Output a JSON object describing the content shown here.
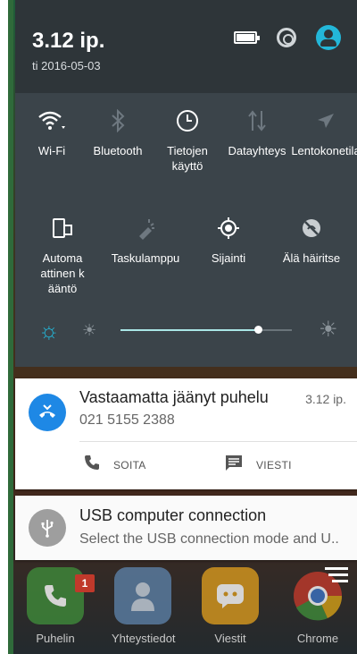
{
  "status": {
    "time": "3.12 ip.",
    "date": "ti 2016-05-03"
  },
  "quick_settings": {
    "row1": [
      {
        "label": "Wi-Fi",
        "icon": "wifi-icon",
        "active": true
      },
      {
        "label": "Bluetooth",
        "icon": "bluetooth-icon",
        "active": false
      },
      {
        "label": "Tietojen käyttö",
        "icon": "data-usage-icon",
        "active": true
      },
      {
        "label": "Datayhteys",
        "icon": "mobile-data-icon",
        "active": false
      },
      {
        "label": "Lentokonetila",
        "icon": "airplane-icon",
        "active": false
      }
    ],
    "row2": [
      {
        "label": "Automaattinen kääntö",
        "icon": "auto-rotate-icon",
        "active": true
      },
      {
        "label": "Taskulamppu",
        "icon": "flashlight-icon",
        "active": false
      },
      {
        "label": "Sijainti",
        "icon": "location-icon",
        "active": true
      },
      {
        "label": "Älä häiritse",
        "icon": "do-not-disturb-icon",
        "active": true
      }
    ],
    "brightness": {
      "level": 0.8,
      "auto": true
    }
  },
  "notifications": {
    "missed_call": {
      "title": "Vastaamatta jäänyt puhelu",
      "time": "3.12 ip.",
      "number": "021 5155 2388",
      "action_call": "SOITA",
      "action_message": "VIESTI"
    },
    "usb": {
      "title": "USB computer connection",
      "text": "Select the USB connection mode and U.."
    }
  },
  "dock": {
    "apps": [
      {
        "label": "Puhelin",
        "badge": "1"
      },
      {
        "label": "Yhteystiedot"
      },
      {
        "label": "Viestit"
      },
      {
        "label": "Chrome"
      }
    ]
  },
  "colors": {
    "accent": "#23b7d9",
    "panel": "#3b444a",
    "missed_call": "#1e88e5"
  }
}
